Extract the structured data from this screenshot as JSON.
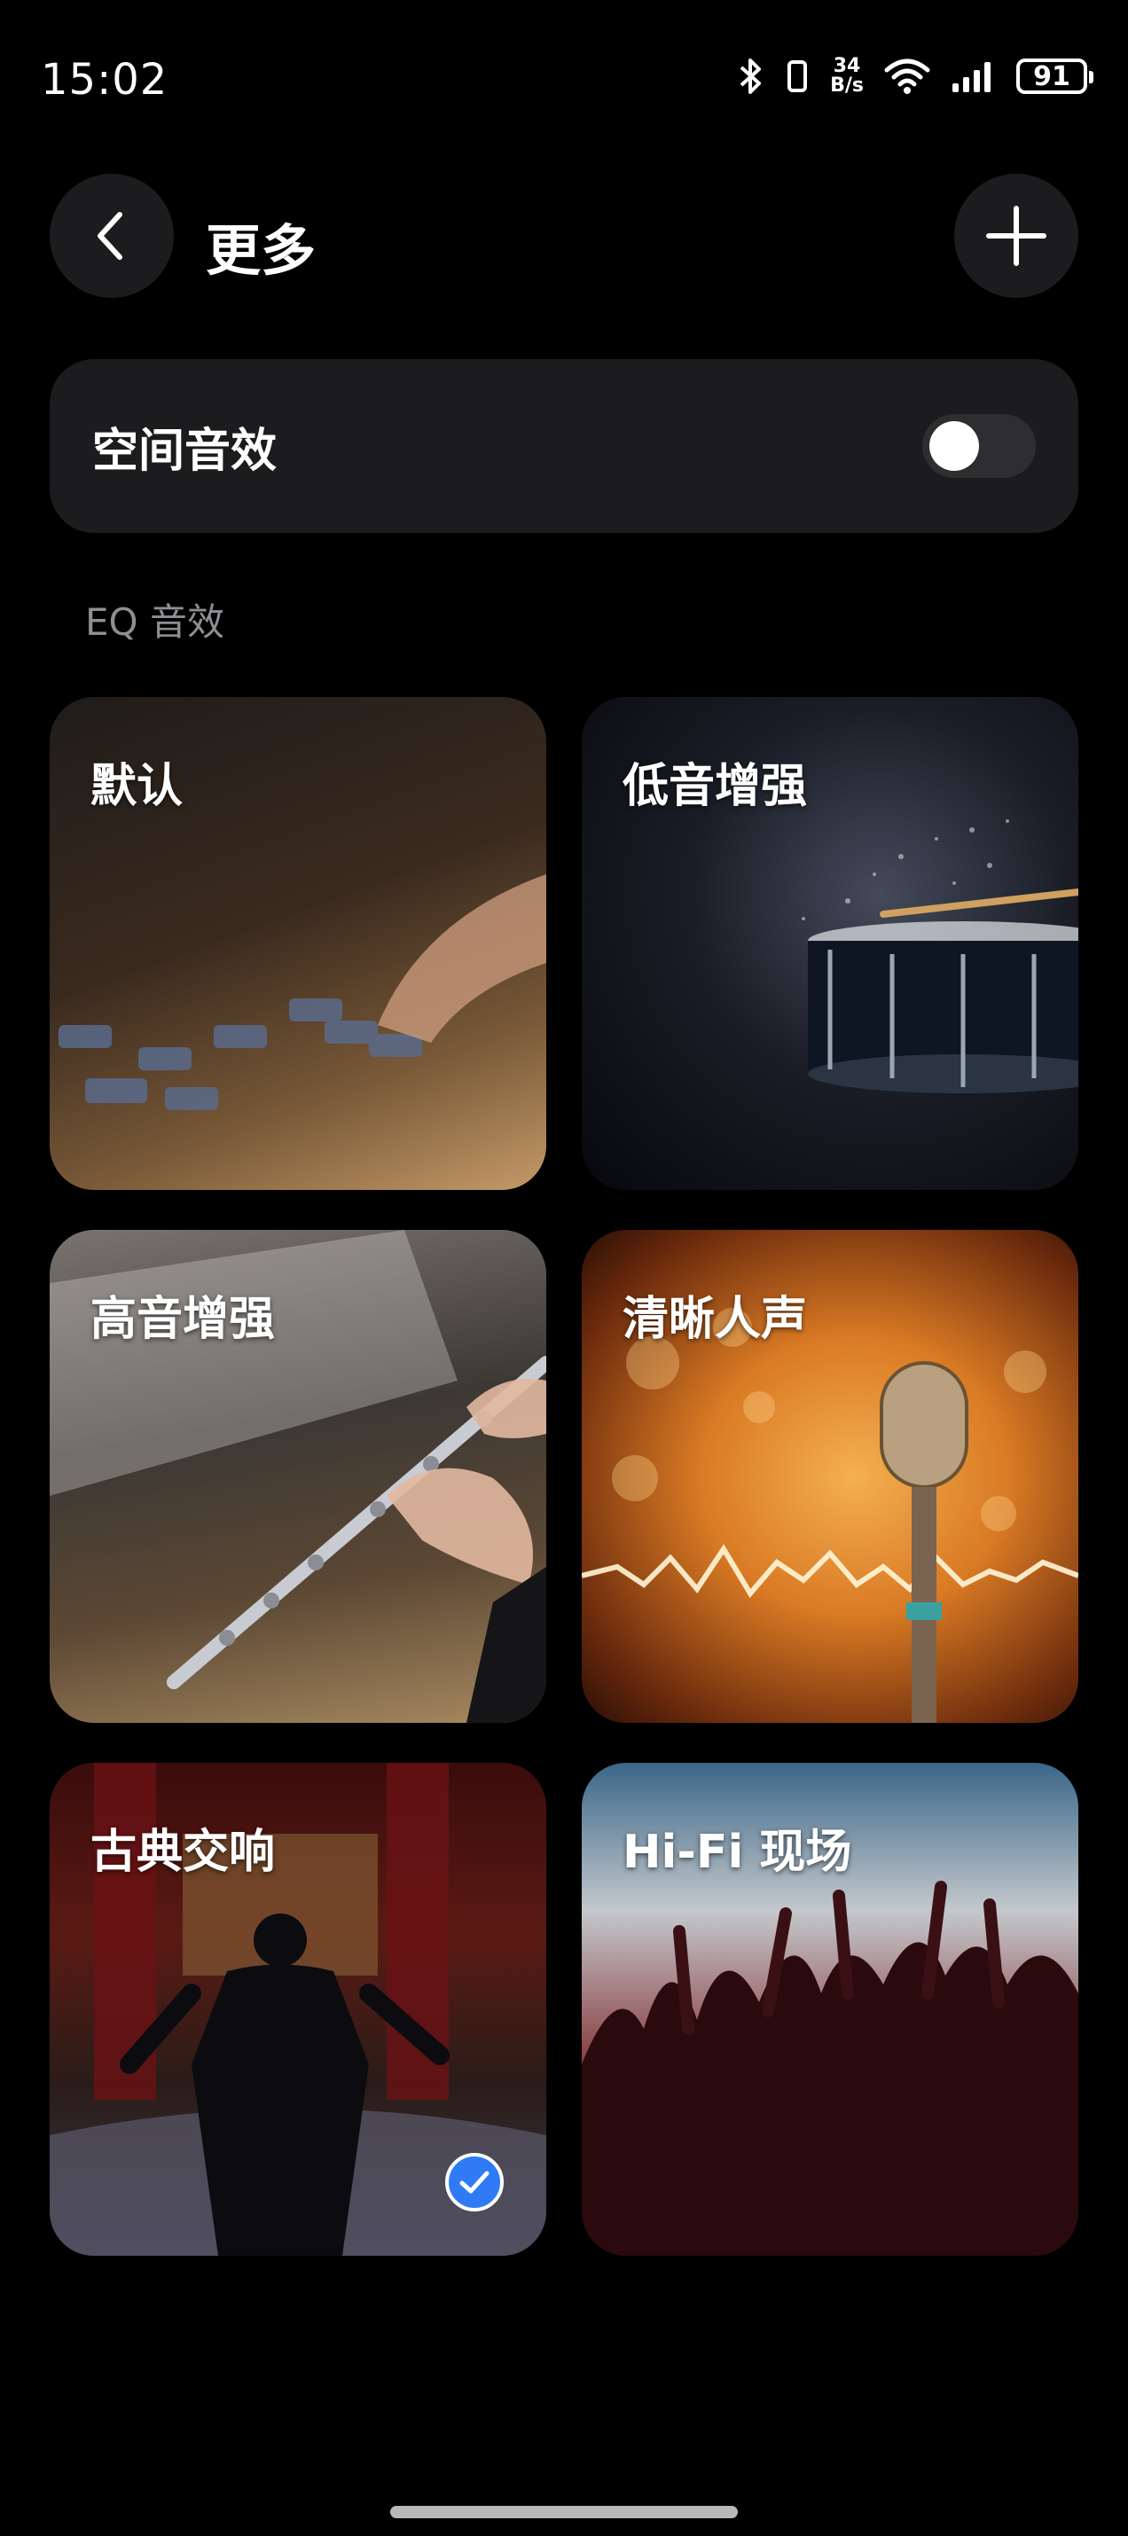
{
  "status_bar": {
    "time": "15:02",
    "net_speed_value": "34",
    "net_speed_unit": "B/s",
    "battery": "91",
    "icons": [
      "bluetooth-icon",
      "vibrate-icon",
      "wifi-icon",
      "signal-icon",
      "battery-icon"
    ]
  },
  "header": {
    "title": "更多",
    "back_icon": "chevron-left-icon",
    "add_icon": "plus-icon"
  },
  "spatial_audio": {
    "label": "空间音效",
    "enabled": false
  },
  "eq_section": {
    "label": "EQ 音效",
    "presets": [
      {
        "label": "默认",
        "selected": false
      },
      {
        "label": "低音增强",
        "selected": false
      },
      {
        "label": "高音增强",
        "selected": false
      },
      {
        "label": "清晰人声",
        "selected": false
      },
      {
        "label": "古典交响",
        "selected": true
      },
      {
        "label": "Hi-Fi 现场",
        "selected": false
      }
    ]
  },
  "colors": {
    "background": "#000000",
    "card": "#1c1c1e",
    "accent_check": "#2f7bf5",
    "secondary_text": "#8e8e93"
  }
}
